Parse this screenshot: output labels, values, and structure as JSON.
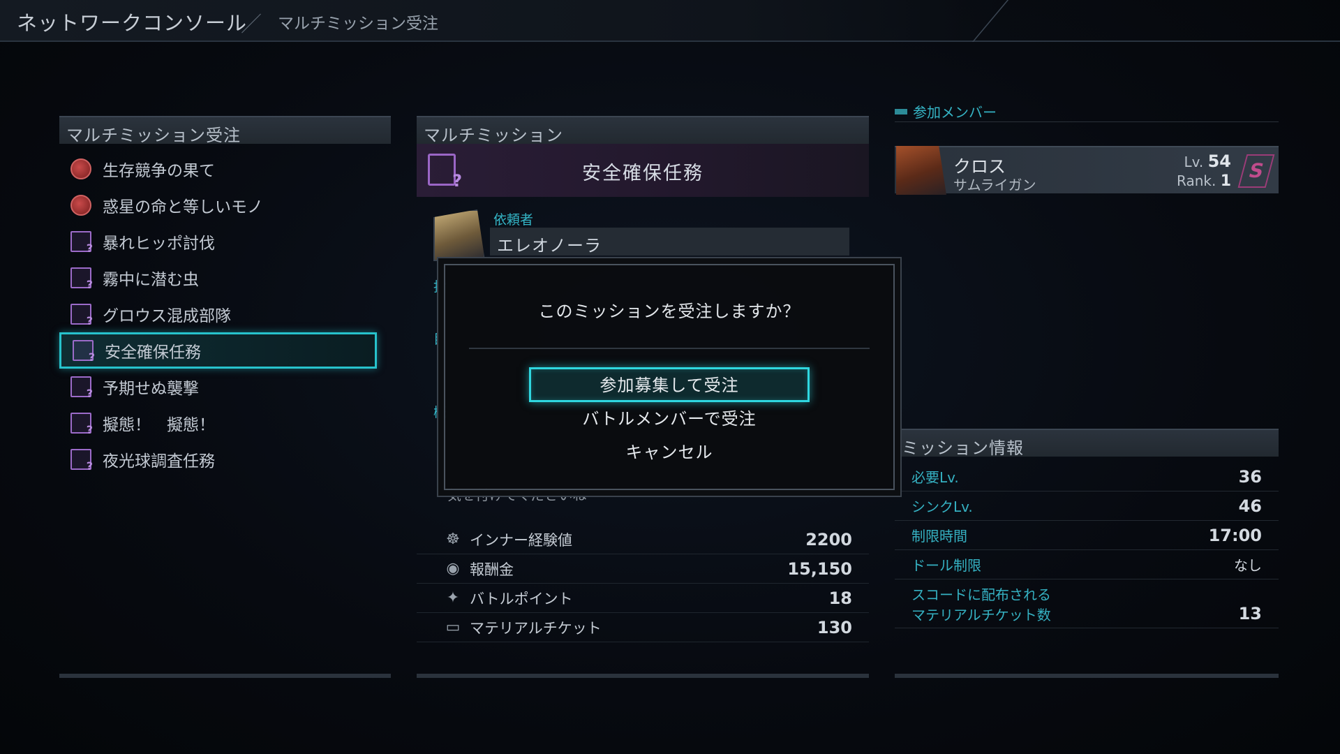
{
  "header": {
    "title": "ネットワークコンソール",
    "subtitle": "マルチミッション受注"
  },
  "left_panel": {
    "title": "マルチミッション受注",
    "missions": [
      {
        "label": "生存競争の果て",
        "icon": "globe-icon",
        "selected": false
      },
      {
        "label": "惑星の命と等しいモノ",
        "icon": "globe-icon",
        "selected": false
      },
      {
        "label": "暴れヒッポ討伐",
        "icon": "document-icon",
        "selected": false
      },
      {
        "label": "霧中に潜む虫",
        "icon": "document-icon",
        "selected": false
      },
      {
        "label": "グロウス混成部隊",
        "icon": "document-icon",
        "selected": false
      },
      {
        "label": "安全確保任務",
        "icon": "document-icon",
        "selected": true
      },
      {
        "label": "予期せぬ襲撃",
        "icon": "document-icon",
        "selected": false
      },
      {
        "label": "擬態！　擬態！",
        "icon": "document-icon",
        "selected": false
      },
      {
        "label": "夜光球調査任務",
        "icon": "document-icon",
        "selected": false
      }
    ]
  },
  "mid_panel": {
    "title": "マルチミッション",
    "mission_name": "安全確保任務",
    "client_label": "依頼者",
    "client_name": "エレオノーラ",
    "partial_label_1": "指",
    "partial_label_2": "目",
    "partial_label_3": "概",
    "desc_tail": "気を付けてくださいね",
    "rewards": [
      {
        "label": "インナー経験値",
        "value": "2200",
        "icon": "experience-icon"
      },
      {
        "label": "報酬金",
        "value": "15,150",
        "icon": "coin-icon"
      },
      {
        "label": "バトルポイント",
        "value": "18",
        "icon": "battle-point-icon"
      },
      {
        "label": "マテリアルチケット",
        "value": "130",
        "icon": "ticket-icon"
      }
    ]
  },
  "member_panel": {
    "title": "参加メンバー",
    "member": {
      "name": "クロス",
      "class": "サムライガン",
      "lv_label": "Lv.",
      "lv": "54",
      "rank_label": "Rank.",
      "rank": "1"
    }
  },
  "info_panel": {
    "title": "ミッション情報",
    "rows": [
      {
        "label": "必要Lv.",
        "value": "36"
      },
      {
        "label": "シンクLv.",
        "value": "46"
      },
      {
        "label": "制限時間",
        "value": "17:00"
      },
      {
        "label": "ドール制限",
        "value": "なし"
      }
    ],
    "last_row": {
      "label_line1": "スコードに配布される",
      "label_line2": "マテリアルチケット数",
      "value": "13"
    }
  },
  "dialog": {
    "question": "このミッションを受注しますか？",
    "options": [
      "参加募集して受注",
      "バトルメンバーで受注",
      "キャンセル"
    ]
  },
  "colors": {
    "accent": "#2fd7e0",
    "label_cyan": "#35b4c5",
    "mission_purple": "#9b66c6"
  }
}
